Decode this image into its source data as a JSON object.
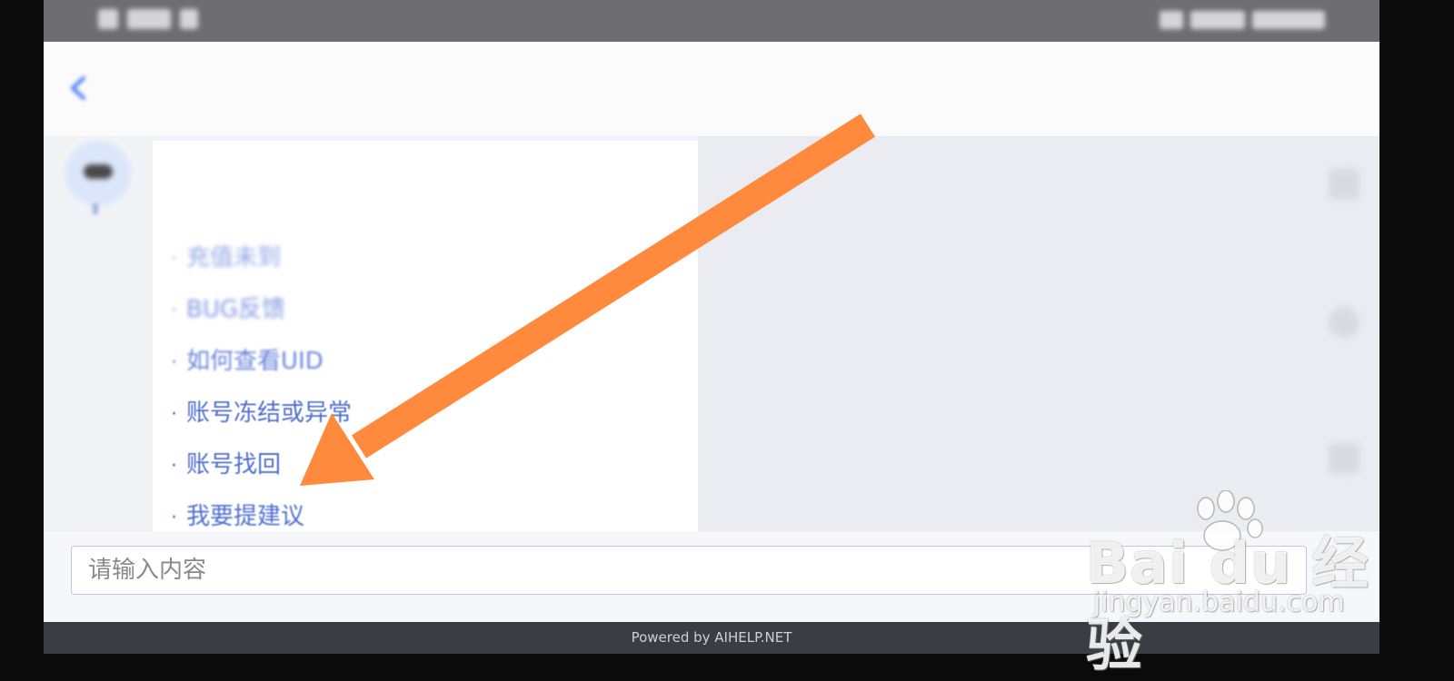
{
  "header": {
    "title": ""
  },
  "bot_message": {
    "intro": "",
    "options": [
      {
        "label": "充值未到"
      },
      {
        "label": "BUG反馈"
      },
      {
        "label": "如何查看UID"
      },
      {
        "label": "账号冻结或异常"
      },
      {
        "label": "账号找回"
      },
      {
        "label": "我要提建议"
      }
    ]
  },
  "composer": {
    "placeholder": "请输入内容"
  },
  "footer": {
    "powered_by": "Powered by AIHELP.NET"
  },
  "watermark": {
    "brand": "Bai du 经验",
    "url": "jingyan.baidu.com"
  },
  "annotation": {
    "arrow_color": "#ff8a3d"
  },
  "colors": {
    "option_link": "#4f6fcf",
    "footer_bg": "#3b3c44"
  }
}
